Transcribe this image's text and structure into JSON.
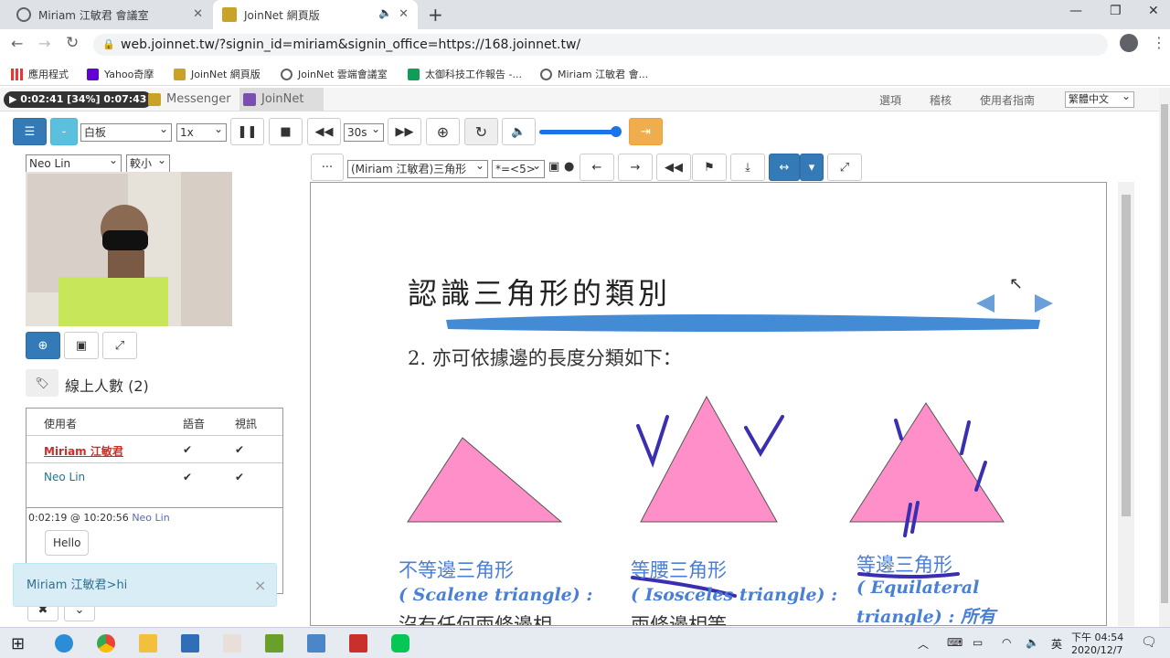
{
  "browser": {
    "tabs": [
      {
        "label": "Miriam 江敏君 會議室"
      },
      {
        "label": "JoinNet 網頁版"
      }
    ],
    "url": "web.joinnet.tw/?signin_id=miriam&signin_office=https://168.joinnet.tw/",
    "bookmarks": [
      "應用程式",
      "Yahoo奇摩",
      "JoinNet 網頁版",
      "JoinNet 雲端會議室",
      "太御科技工作報告 -...",
      "Miriam 江敏君 會..."
    ]
  },
  "appbar": {
    "timer": "▶ 0:02:41 [34%] 0:07:43",
    "tabs": [
      "Messenger",
      "JoinNet"
    ],
    "links": [
      "選項",
      "稽核",
      "使用者指南"
    ],
    "language": "繁體中文"
  },
  "controls": {
    "menu_button": "☰",
    "minus_button": "-",
    "mode_select": "白板",
    "speed_select": "1x",
    "skip_select": "30s",
    "volume_level": 0.95
  },
  "video_panel": {
    "user_select": "Neo Lin",
    "size_select": "較小",
    "online_label": "線上人數 (2)"
  },
  "user_table": {
    "headers": [
      "使用者",
      "語音",
      "視訊"
    ],
    "rows": [
      {
        "name": "Miriam 江敏君",
        "voice": "✔",
        "video": "✔",
        "color": "#c9302c"
      },
      {
        "name": "Neo Lin",
        "voice": "✔",
        "video": "✔",
        "color": "#1a7a8c"
      }
    ]
  },
  "chat": {
    "meta": "0:02:19 @ 10:20:56",
    "author": "Neo Lin",
    "message": "Hello"
  },
  "toast": {
    "text": "Miriam 江敏君>hi",
    "close": "×"
  },
  "whiteboard_toolbar": {
    "more": "···",
    "page_select": "(Miriam 江敏君)三角形",
    "zoom_select": "*=<5>"
  },
  "slide": {
    "title": "認識三角形的類別",
    "subtitle": "2. 亦可依據邊的長度分類如下：",
    "triangles": [
      {
        "name": "不等邊三角形",
        "en": "( Scalene  triangle) :",
        "desc": "沒有任何兩條邊相"
      },
      {
        "name": "等腰三角形",
        "en": "( Isosceles  triangle) :",
        "desc": "兩條邊相等。"
      },
      {
        "name": "等邊三角形",
        "en": "( Equilateral",
        "en2": "triangle) : 所有"
      }
    ],
    "nav": [
      "◀",
      "▶"
    ],
    "colors": {
      "triangle": "#ff8fc8",
      "heading_blue": "#4a7fd6",
      "ink": "#3a2fb0",
      "brush": "#2f7fd0"
    }
  },
  "taskbar": {
    "ime": "英",
    "time": "下午 04:54",
    "date": "2020/12/7"
  }
}
